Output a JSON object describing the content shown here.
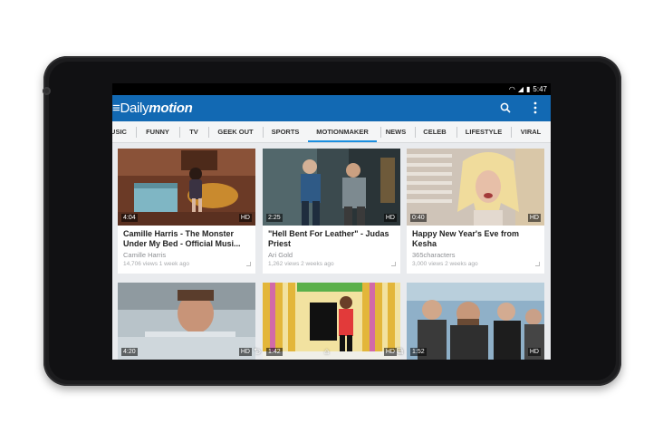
{
  "status": {
    "time": "5:47",
    "wifi_icon": "wifi-icon",
    "signal_icon": "signal-icon",
    "battery_icon": "battery-icon"
  },
  "app": {
    "logo_part1": "≡Daily",
    "logo_part2": "motion",
    "search_icon": "search-icon",
    "more_icon": "overflow-menu-icon",
    "brand_color": "#1269b3",
    "accent_color": "#1b8fe0"
  },
  "tabs": [
    {
      "label": "USIC"
    },
    {
      "label": "FUNNY"
    },
    {
      "label": "TV"
    },
    {
      "label": "GEEK OUT"
    },
    {
      "label": "SPORTS"
    },
    {
      "label": "MOTIONMAKER"
    },
    {
      "label": "NEWS"
    },
    {
      "label": "CELEB"
    },
    {
      "label": "LIFESTYLE"
    },
    {
      "label": "VIRAL"
    }
  ],
  "videos": [
    {
      "duration": "4:04",
      "quality": "HD",
      "title": "Camille Harris - The Monster Under My Bed - Official Musi...",
      "channel": "Camille Harris",
      "meta": "14,706 views   1 week ago"
    },
    {
      "duration": "2:25",
      "quality": "HD",
      "title": "\"Hell Bent For Leather\" - Judas Priest",
      "channel": "Ari Gold",
      "meta": "1,262 views   2 weeks ago"
    },
    {
      "duration": "0:40",
      "quality": "HD",
      "title": "Happy New Year's Eve from Kesha",
      "channel": "365characters",
      "meta": "3,000 views   2 weeks ago"
    },
    {
      "duration": "4:20",
      "quality": "HD"
    },
    {
      "duration": "1:42",
      "quality": "HD"
    },
    {
      "duration": "1:52",
      "quality": "HD"
    }
  ],
  "nav": {
    "back_icon": "back-icon",
    "home_icon": "home-icon",
    "recents_icon": "recent-apps-icon"
  }
}
